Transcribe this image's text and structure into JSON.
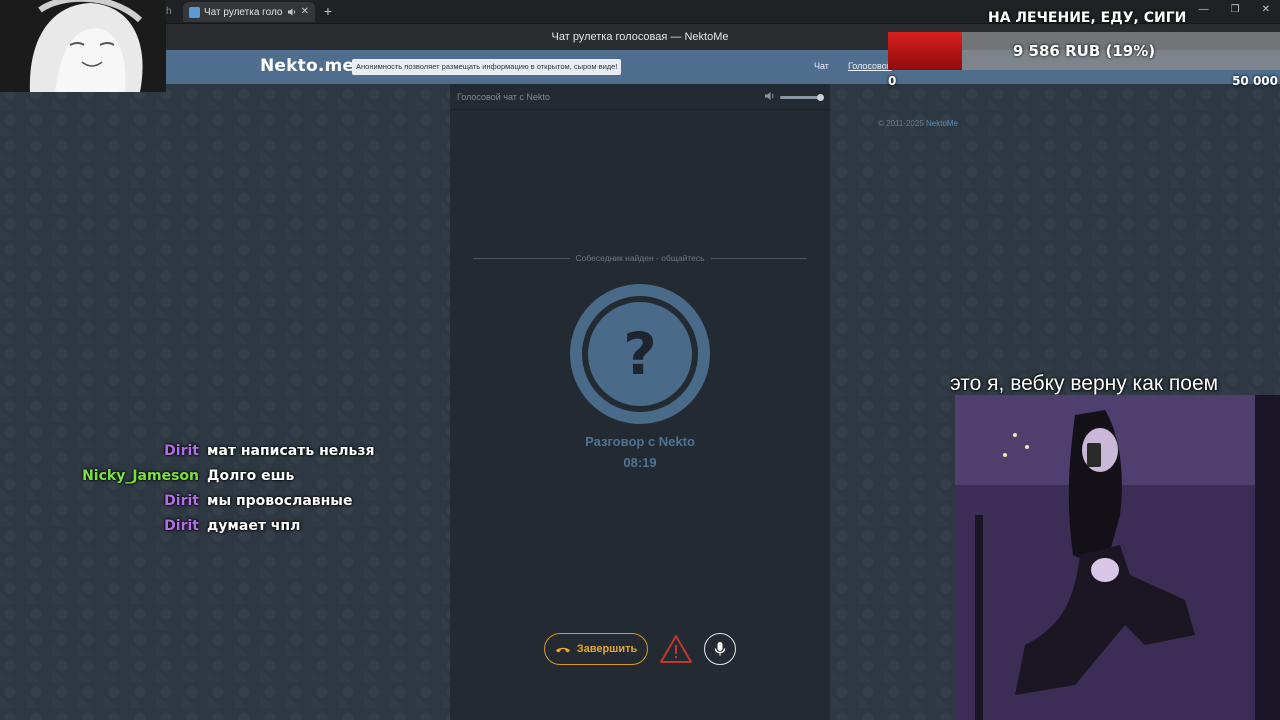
{
  "browser": {
    "prev_tab_fragment": "h",
    "active_tab": {
      "title": "Чат рулетка голосовая",
      "sound_icon": "speaker-icon",
      "close_icon": "close-icon"
    },
    "new_tab_icon": "plus-icon",
    "window_title": "Чат рулетка голосовая — NektoMe",
    "window_controls": [
      "minimize-icon",
      "restore-icon",
      "close-icon"
    ]
  },
  "site": {
    "logo": "Nekto.me",
    "notice": "Анонимность позволяет размещать информацию в открытом, сыром виде!",
    "nav": {
      "chat": "Чат",
      "voice": "Голосовой"
    },
    "copyright_prefix": "© 2011-2025",
    "copyright_brand": "NektoMe"
  },
  "voice_panel": {
    "title": "Голосовой чат с Nekto",
    "volume_icon": "volume-icon",
    "volume_level": 1.0,
    "status": "Собеседник найден - общайтесь",
    "avatar_icon": "question-mark-icon",
    "avatar_glyph": "?",
    "talk_label": "Разговор с Nekto",
    "timer": "08:19",
    "end_button": "Завершить",
    "end_icon": "phone-hangup-icon",
    "report_icon": "warning-icon",
    "mic_icon": "microphone-icon"
  },
  "overlay": {
    "goal": {
      "title": "НА ЛЕЧЕНИЕ, ЕДУ, СИГИ",
      "amount_text": "9 586 RUB (19%)",
      "progress": 0.19,
      "min_label": "0",
      "max_label": "50 000"
    },
    "chat": [
      {
        "user": "Dirit",
        "color": "#b06ee8",
        "text": "мат написать нельзя"
      },
      {
        "user": "Nicky_Jameson",
        "color": "#7ae23c",
        "text": "Долго ешь"
      },
      {
        "user": "Dirit",
        "color": "#b06ee8",
        "text": "мы провославные"
      },
      {
        "user": "Dirit",
        "color": "#b06ee8",
        "text": "думает чпл"
      }
    ],
    "cam_caption": "это я, вебку верну как поем"
  },
  "colors": {
    "header": "#4f6d8c",
    "accent_blue": "#4a6a8a",
    "end_button": "#e8a726",
    "warning": "#c0392b"
  }
}
